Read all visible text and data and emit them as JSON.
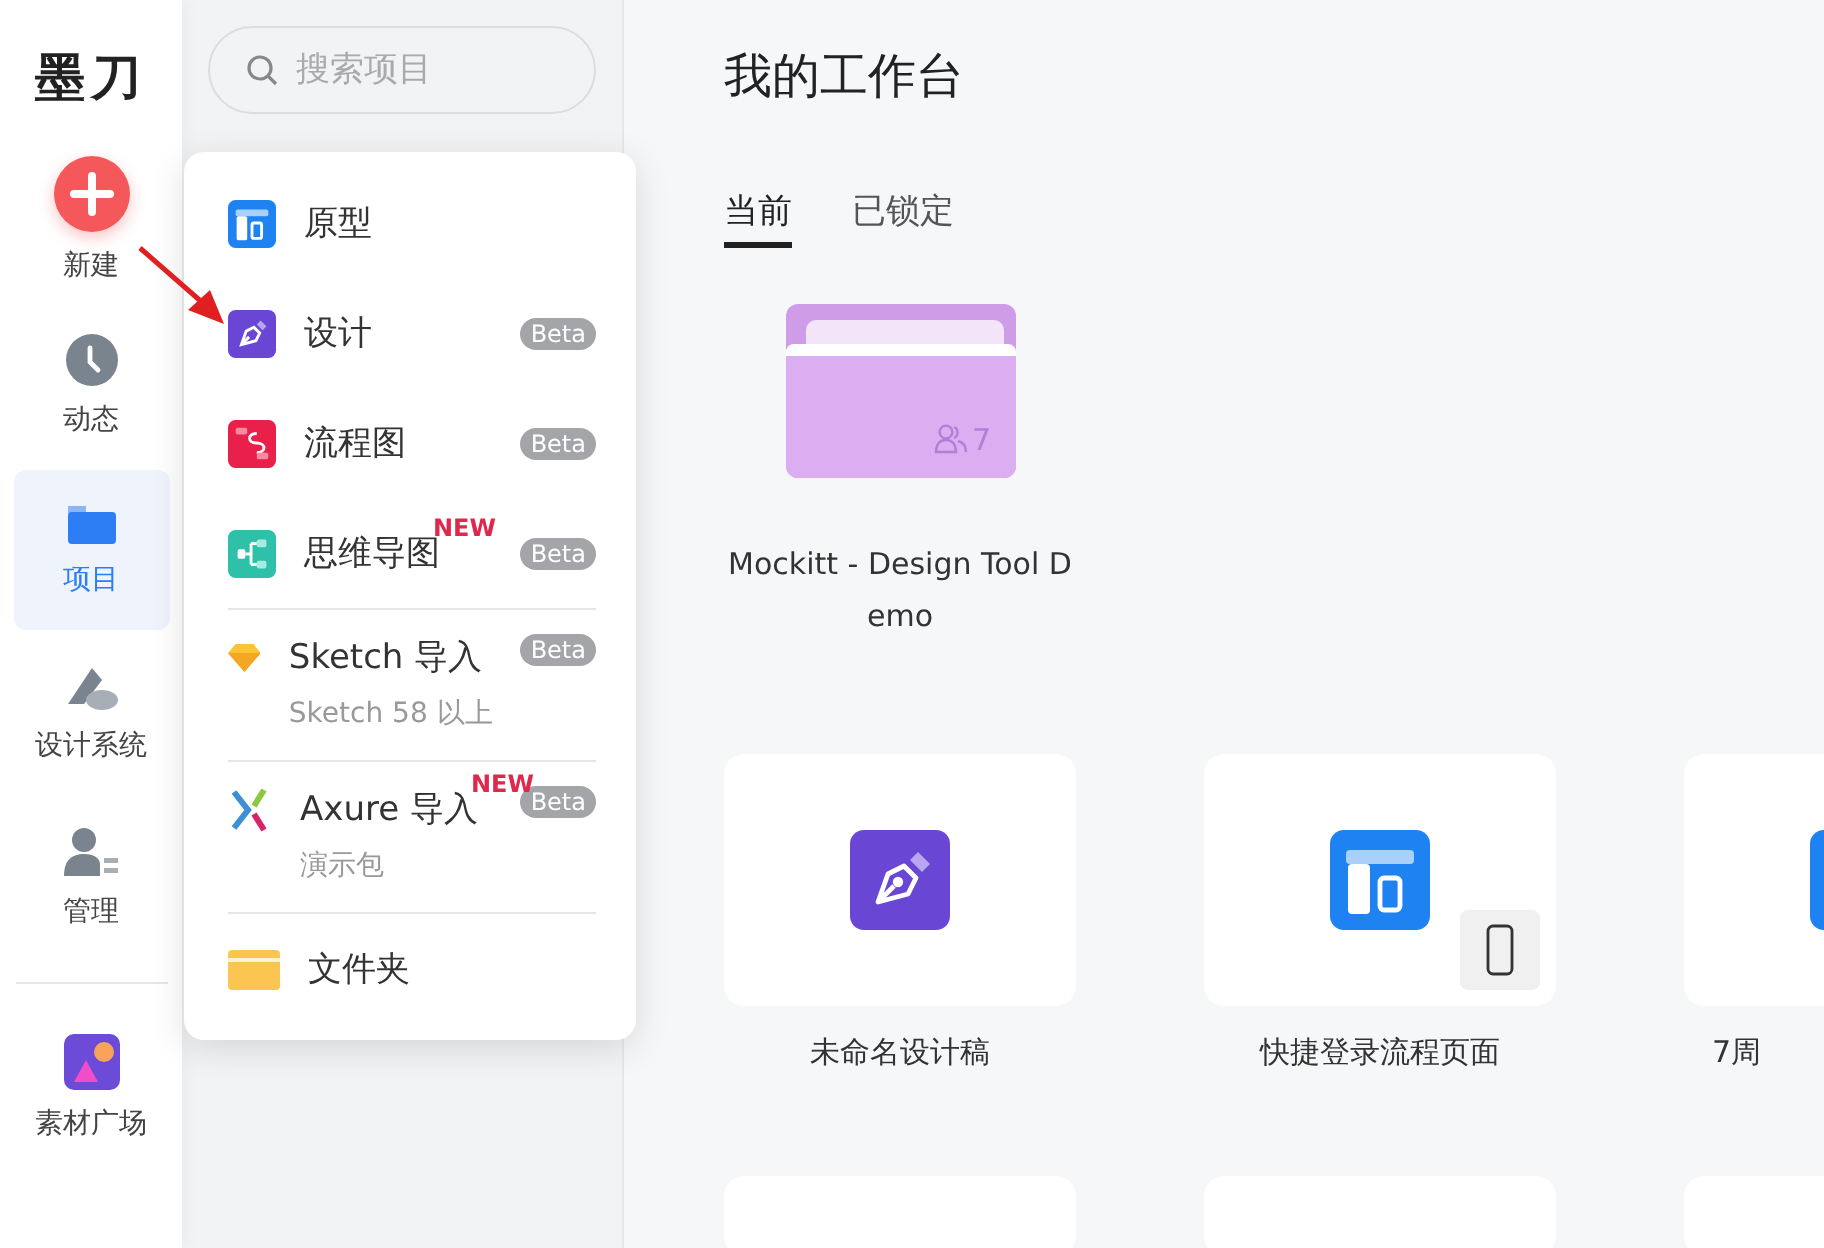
{
  "logo": "墨刀",
  "nav": [
    {
      "kind": "new",
      "label": "新建",
      "selected": false
    },
    {
      "kind": "clock",
      "label": "动态",
      "selected": false
    },
    {
      "kind": "folder",
      "label": "项目",
      "selected": true
    },
    {
      "kind": "design-system",
      "label": "设计系统",
      "selected": false
    },
    {
      "kind": "people",
      "label": "管理",
      "selected": false
    },
    {
      "kind": "market",
      "label": "素材广场",
      "selected": false
    }
  ],
  "search": {
    "placeholder": "搜索项目"
  },
  "menu": [
    [
      {
        "kind": "prototype",
        "label": "原型"
      },
      {
        "kind": "design",
        "label": "设计",
        "badge": "Beta"
      },
      {
        "kind": "flow",
        "label": "流程图",
        "badge": "Beta"
      },
      {
        "kind": "mind",
        "label": "思维导图",
        "badge": "Beta",
        "flag": "NEW"
      }
    ],
    [
      {
        "kind": "sketch",
        "label": "Sketch 导入",
        "badge": "Beta",
        "sub": "Sketch 58 以上"
      }
    ],
    [
      {
        "kind": "axure",
        "label": "Axure 导入",
        "badge": "Beta",
        "flag": "NEW",
        "sub": "演示包"
      }
    ],
    [
      {
        "kind": "folder",
        "label": "文件夹"
      }
    ]
  ],
  "title": "我的工作台",
  "tabs": [
    {
      "label": "当前",
      "selected": true
    },
    {
      "label": "已锁定",
      "selected": false
    }
  ],
  "folders": [
    {
      "name": "Mockitt - Design Tool Demo",
      "members": "7"
    }
  ],
  "files": [
    {
      "kind": "design",
      "name": "未命名设计稿",
      "mobile": false
    },
    {
      "kind": "prototype",
      "name": "快捷登录流程页面",
      "mobile": true
    },
    {
      "kind": "prototype",
      "name": "7周"
    }
  ]
}
